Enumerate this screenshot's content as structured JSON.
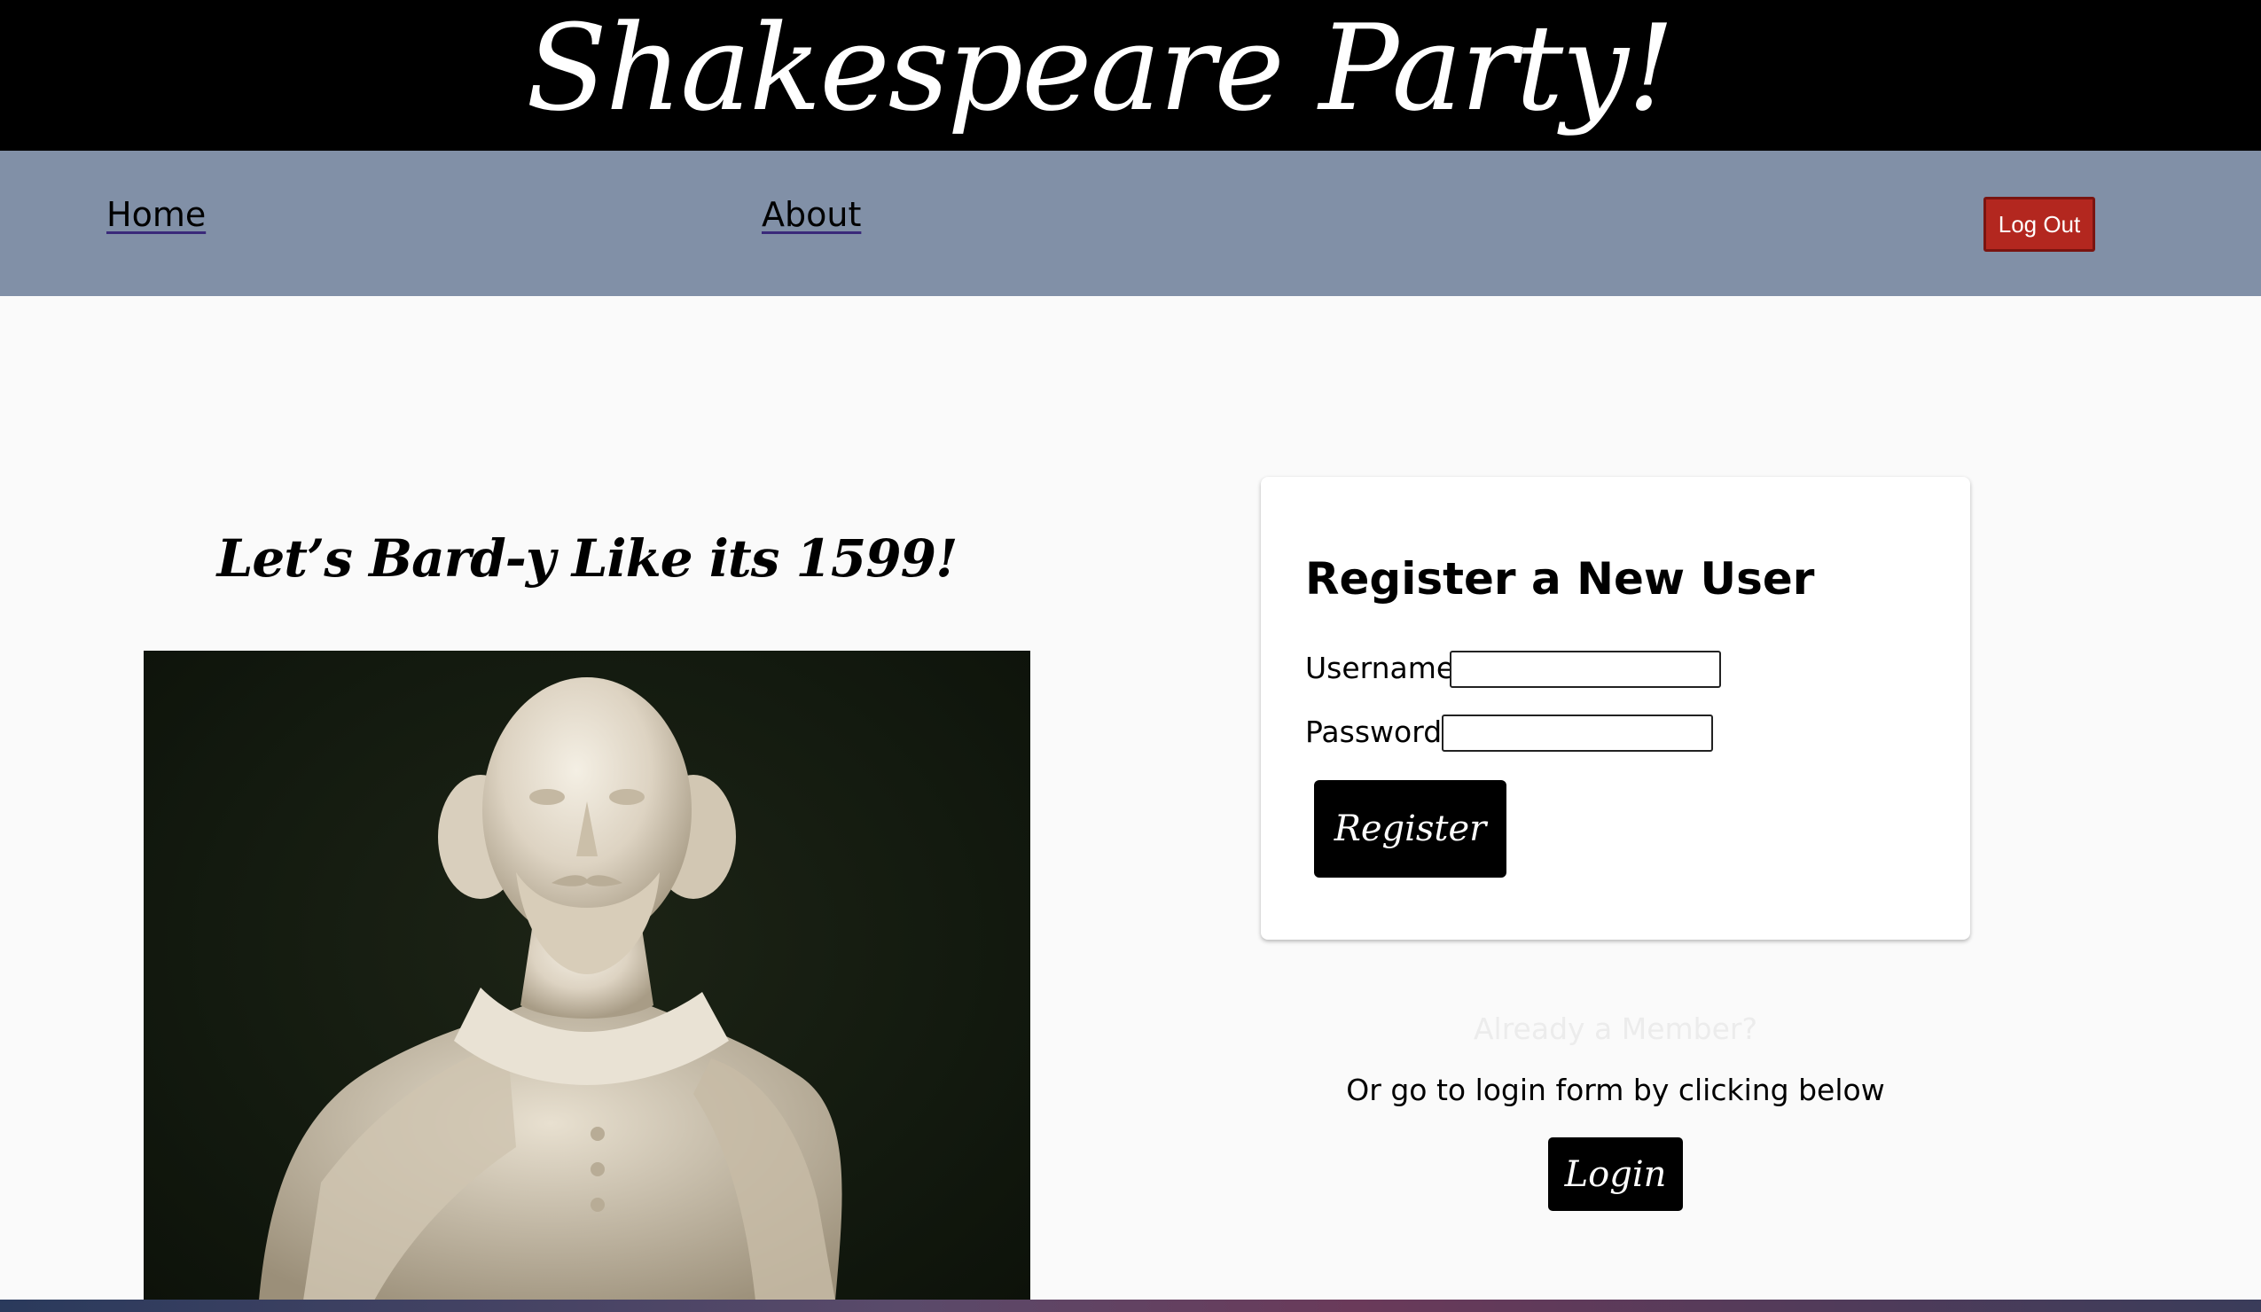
{
  "header": {
    "title": "Shakespeare Party!"
  },
  "nav": {
    "home_label": "Home",
    "about_label": "About",
    "logout_label": "Log Out"
  },
  "hero": {
    "tagline": "Let’s Bard-y Like its 1599!",
    "image_alt": "White marble bust of William Shakespeare on a dark green background"
  },
  "register_form": {
    "title": "Register a New User",
    "username_label": "Username:",
    "username_value": "",
    "password_label": "Password:",
    "password_value": "",
    "submit_label": "Register"
  },
  "login_section": {
    "already_member": "Already a Member?",
    "hint": "Or go to login form by clicking below",
    "login_label": "Login"
  },
  "colors": {
    "header_bg": "#000000",
    "nav_bg": "#8190a7",
    "logout_bg": "#b3271f",
    "page_bg": "#fafafa",
    "button_bg": "#000000"
  }
}
